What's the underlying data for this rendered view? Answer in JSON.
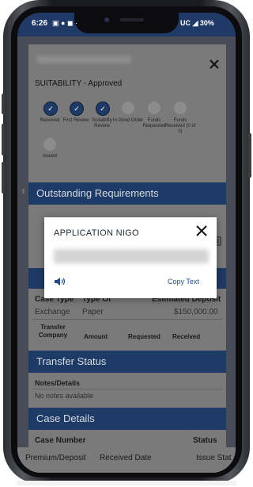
{
  "status_bar": {
    "time": "6:26",
    "icons": "▣ ● ◼ ·",
    "right": "UC ◢ 30%"
  },
  "page": {
    "suitability": "SUITABILITY - Approved",
    "steps": [
      {
        "label": "Received",
        "done": true
      },
      {
        "label": "First Review",
        "done": true
      },
      {
        "label": "Suitability Review",
        "done": true
      },
      {
        "label": "In Good Order",
        "done": false
      },
      {
        "label": "Funds Requested",
        "done": false
      },
      {
        "label": "Funds Received (0 of 0)",
        "done": false
      },
      {
        "label": "Issued",
        "done": false
      }
    ],
    "outstanding_title": "Outstanding Requirements",
    "case_table": {
      "headers": [
        "Case Type",
        "Type Of",
        "Estimated Deposit"
      ],
      "values": [
        "Exchange",
        "Paper",
        "$150,000.00"
      ],
      "sub_headers": [
        "Transfer Company",
        "Amount",
        "Requested",
        "Received"
      ]
    },
    "transfer_status_title": "Transfer Status",
    "notes_label": "Notes/Details",
    "notes_value": "No notes available",
    "case_details_title": "Case Details",
    "case_details_headers": [
      "Case Number",
      "Status"
    ],
    "bottom_row": [
      "Premium/Deposit",
      "Received Date",
      "Issue Stat"
    ]
  },
  "dialog": {
    "title": "APPLICATION NIGO",
    "copy_label": "Copy Text"
  },
  "colors": {
    "nav_blue": "#1e3a66",
    "link_blue": "#1f4d8a"
  }
}
